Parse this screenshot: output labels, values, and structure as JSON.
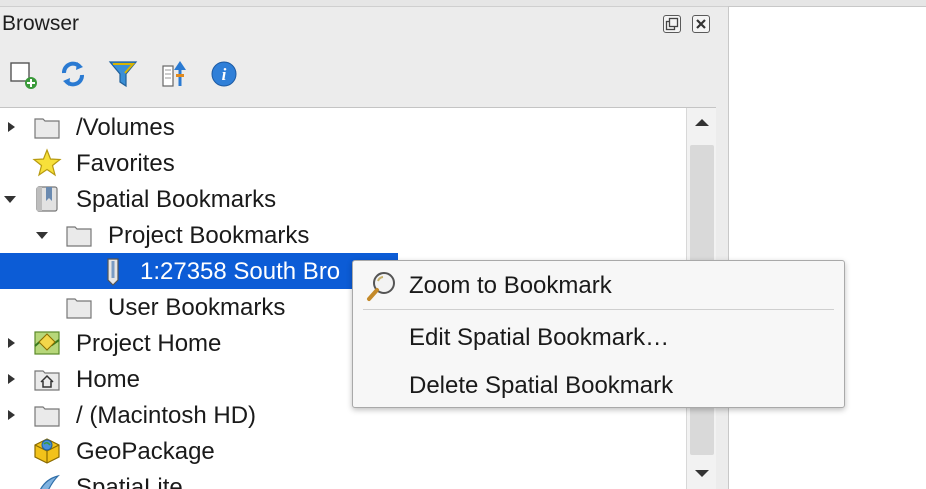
{
  "panel": {
    "title": "Browser"
  },
  "window_buttons": [
    {
      "icon": "float-icon",
      "glyph": "⧉"
    },
    {
      "icon": "close-icon",
      "glyph": "✕"
    }
  ],
  "toolbar": {
    "buttons": [
      {
        "icon": "add-layer-icon"
      },
      {
        "icon": "refresh-icon"
      },
      {
        "icon": "filter-icon"
      },
      {
        "icon": "collapse-all-icon"
      },
      {
        "icon": "info-icon"
      }
    ]
  },
  "tree": {
    "items": [
      {
        "label": "/Volumes",
        "icon": "folder-icon",
        "expander": "collapsed"
      },
      {
        "label": "Favorites",
        "icon": "star-icon",
        "expander": "none"
      },
      {
        "label": "Spatial Bookmarks",
        "icon": "bookmark-book-icon",
        "expander": "expanded"
      },
      {
        "label": "Project Bookmarks",
        "icon": "folder-icon",
        "expander": "expanded"
      },
      {
        "label": "1:27358 South Bro",
        "icon": "bookmark-icon",
        "expander": "none",
        "selected": true
      },
      {
        "label": "User Bookmarks",
        "icon": "folder-icon",
        "expander": "none"
      },
      {
        "label": "Project Home",
        "icon": "project-home-icon",
        "expander": "collapsed"
      },
      {
        "label": "Home",
        "icon": "home-folder-icon",
        "expander": "collapsed"
      },
      {
        "label": "/ (Macintosh HD)",
        "icon": "folder-icon",
        "expander": "collapsed"
      },
      {
        "label": "GeoPackage",
        "icon": "geopackage-icon",
        "expander": "none"
      },
      {
        "label": "SpatiaLite",
        "icon": "spatialite-icon",
        "expander": "none"
      }
    ]
  },
  "context_menu": {
    "items": [
      {
        "label": "Zoom to Bookmark",
        "icon": "zoom-icon"
      },
      {
        "label": "Edit Spatial Bookmark…",
        "icon": ""
      },
      {
        "label": "Delete Spatial Bookmark",
        "icon": ""
      }
    ]
  },
  "colors": {
    "selection": "#0c5cd6",
    "folder": "#e8e8e8",
    "star": "#f7e03a"
  }
}
